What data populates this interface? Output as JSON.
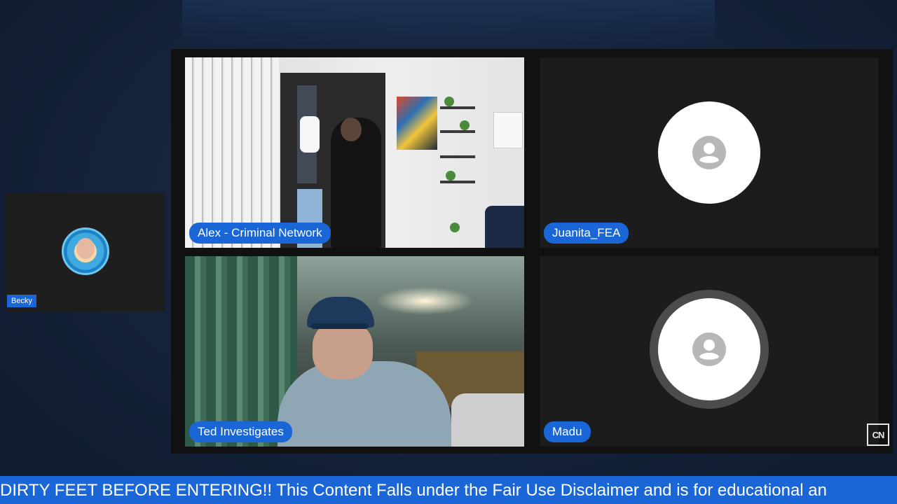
{
  "participants": [
    {
      "name": "Alex - Criminal Network",
      "video": "on"
    },
    {
      "name": "Juanita_FEA",
      "video": "off"
    },
    {
      "name": "Ted Investigates",
      "video": "on"
    },
    {
      "name": "Madu",
      "video": "off"
    }
  ],
  "sidebar_participant": {
    "name": "Becky"
  },
  "watermark": {
    "text": "CN"
  },
  "ticker": {
    "text": "DIRTY FEET BEFORE ENTERING!! This Content Falls under the Fair Use Disclaimer and is for educational an"
  },
  "colors": {
    "accent": "#1a66d6",
    "background": "#14223a",
    "tile": "#1c1c1c"
  }
}
